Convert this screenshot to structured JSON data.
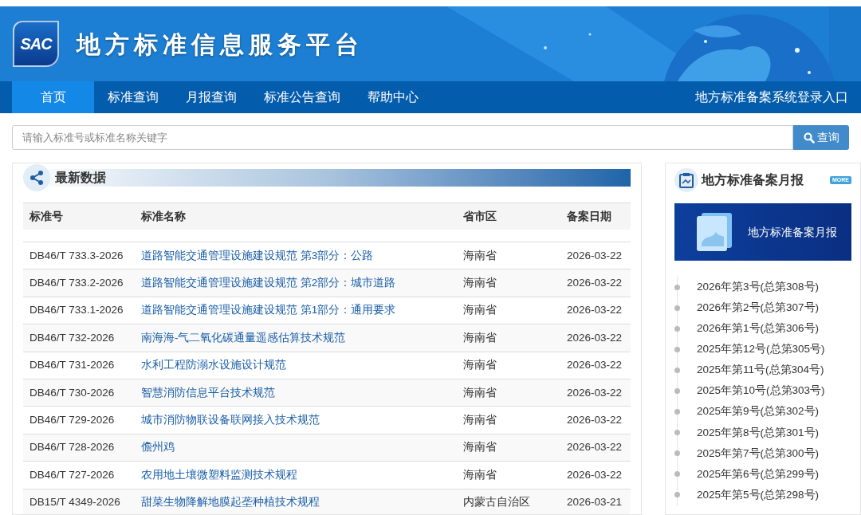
{
  "header": {
    "logo_text": "SAC",
    "title": "地方标准信息服务平台"
  },
  "nav": {
    "items": [
      {
        "label": "首页",
        "selected": true
      },
      {
        "label": "标准查询",
        "selected": false
      },
      {
        "label": "月报查询",
        "selected": false
      },
      {
        "label": "标准公告查询",
        "selected": false
      },
      {
        "label": "帮助中心",
        "selected": false
      }
    ],
    "login_link": "地方标准备案系统登录入口"
  },
  "search": {
    "placeholder": "请输入标准号或标准名称关键字",
    "button": "查询"
  },
  "latest": {
    "title": "最新数据",
    "columns": [
      "标准号",
      "标准名称",
      "省市区",
      "备案日期"
    ],
    "rows": [
      {
        "code": "DB46/T 733.3-2026",
        "name": "道路智能交通管理设施建设规范 第3部分：公路",
        "region": "海南省",
        "date": "2026-03-22"
      },
      {
        "code": "DB46/T 733.2-2026",
        "name": "道路智能交通管理设施建设规范 第2部分：城市道路",
        "region": "海南省",
        "date": "2026-03-22"
      },
      {
        "code": "DB46/T 733.1-2026",
        "name": "道路智能交通管理设施建设规范 第1部分：通用要求",
        "region": "海南省",
        "date": "2026-03-22"
      },
      {
        "code": "DB46/T 732-2026",
        "name": "南海海-气二氧化碳通量遥感估算技术规范",
        "region": "海南省",
        "date": "2026-03-22"
      },
      {
        "code": "DB46/T 731-2026",
        "name": "水利工程防溺水设施设计规范",
        "region": "海南省",
        "date": "2026-03-22"
      },
      {
        "code": "DB46/T 730-2026",
        "name": "智慧消防信息平台技术规范",
        "region": "海南省",
        "date": "2026-03-22"
      },
      {
        "code": "DB46/T 729-2026",
        "name": "城市消防物联设备联网接入技术规范",
        "region": "海南省",
        "date": "2026-03-22"
      },
      {
        "code": "DB46/T 728-2026",
        "name": "儋州鸡",
        "region": "海南省",
        "date": "2026-03-22"
      },
      {
        "code": "DB46/T 727-2026",
        "name": "农用地土壤微塑料监测技术规程",
        "region": "海南省",
        "date": "2026-03-22"
      },
      {
        "code": "DB15/T 4349-2026",
        "name": "甜菜生物降解地膜起垄种植技术规程",
        "region": "内蒙古自治区",
        "date": "2026-03-21"
      }
    ]
  },
  "monthly": {
    "title": "地方标准备案月报",
    "more": "MORE",
    "banner_text": "地方标准备案月报",
    "items": [
      "2026年第3号(总第308号)",
      "2026年第2号(总第307号)",
      "2026年第1号(总第306号)",
      "2025年第12号(总第305号)",
      "2025年第11号(总第304号)",
      "2025年第10号(总第303号)",
      "2025年第9号(总第302号)",
      "2025年第8号(总第301号)",
      "2025年第7号(总第300号)",
      "2025年第6号(总第299号)",
      "2025年第5号(总第298号)"
    ]
  }
}
